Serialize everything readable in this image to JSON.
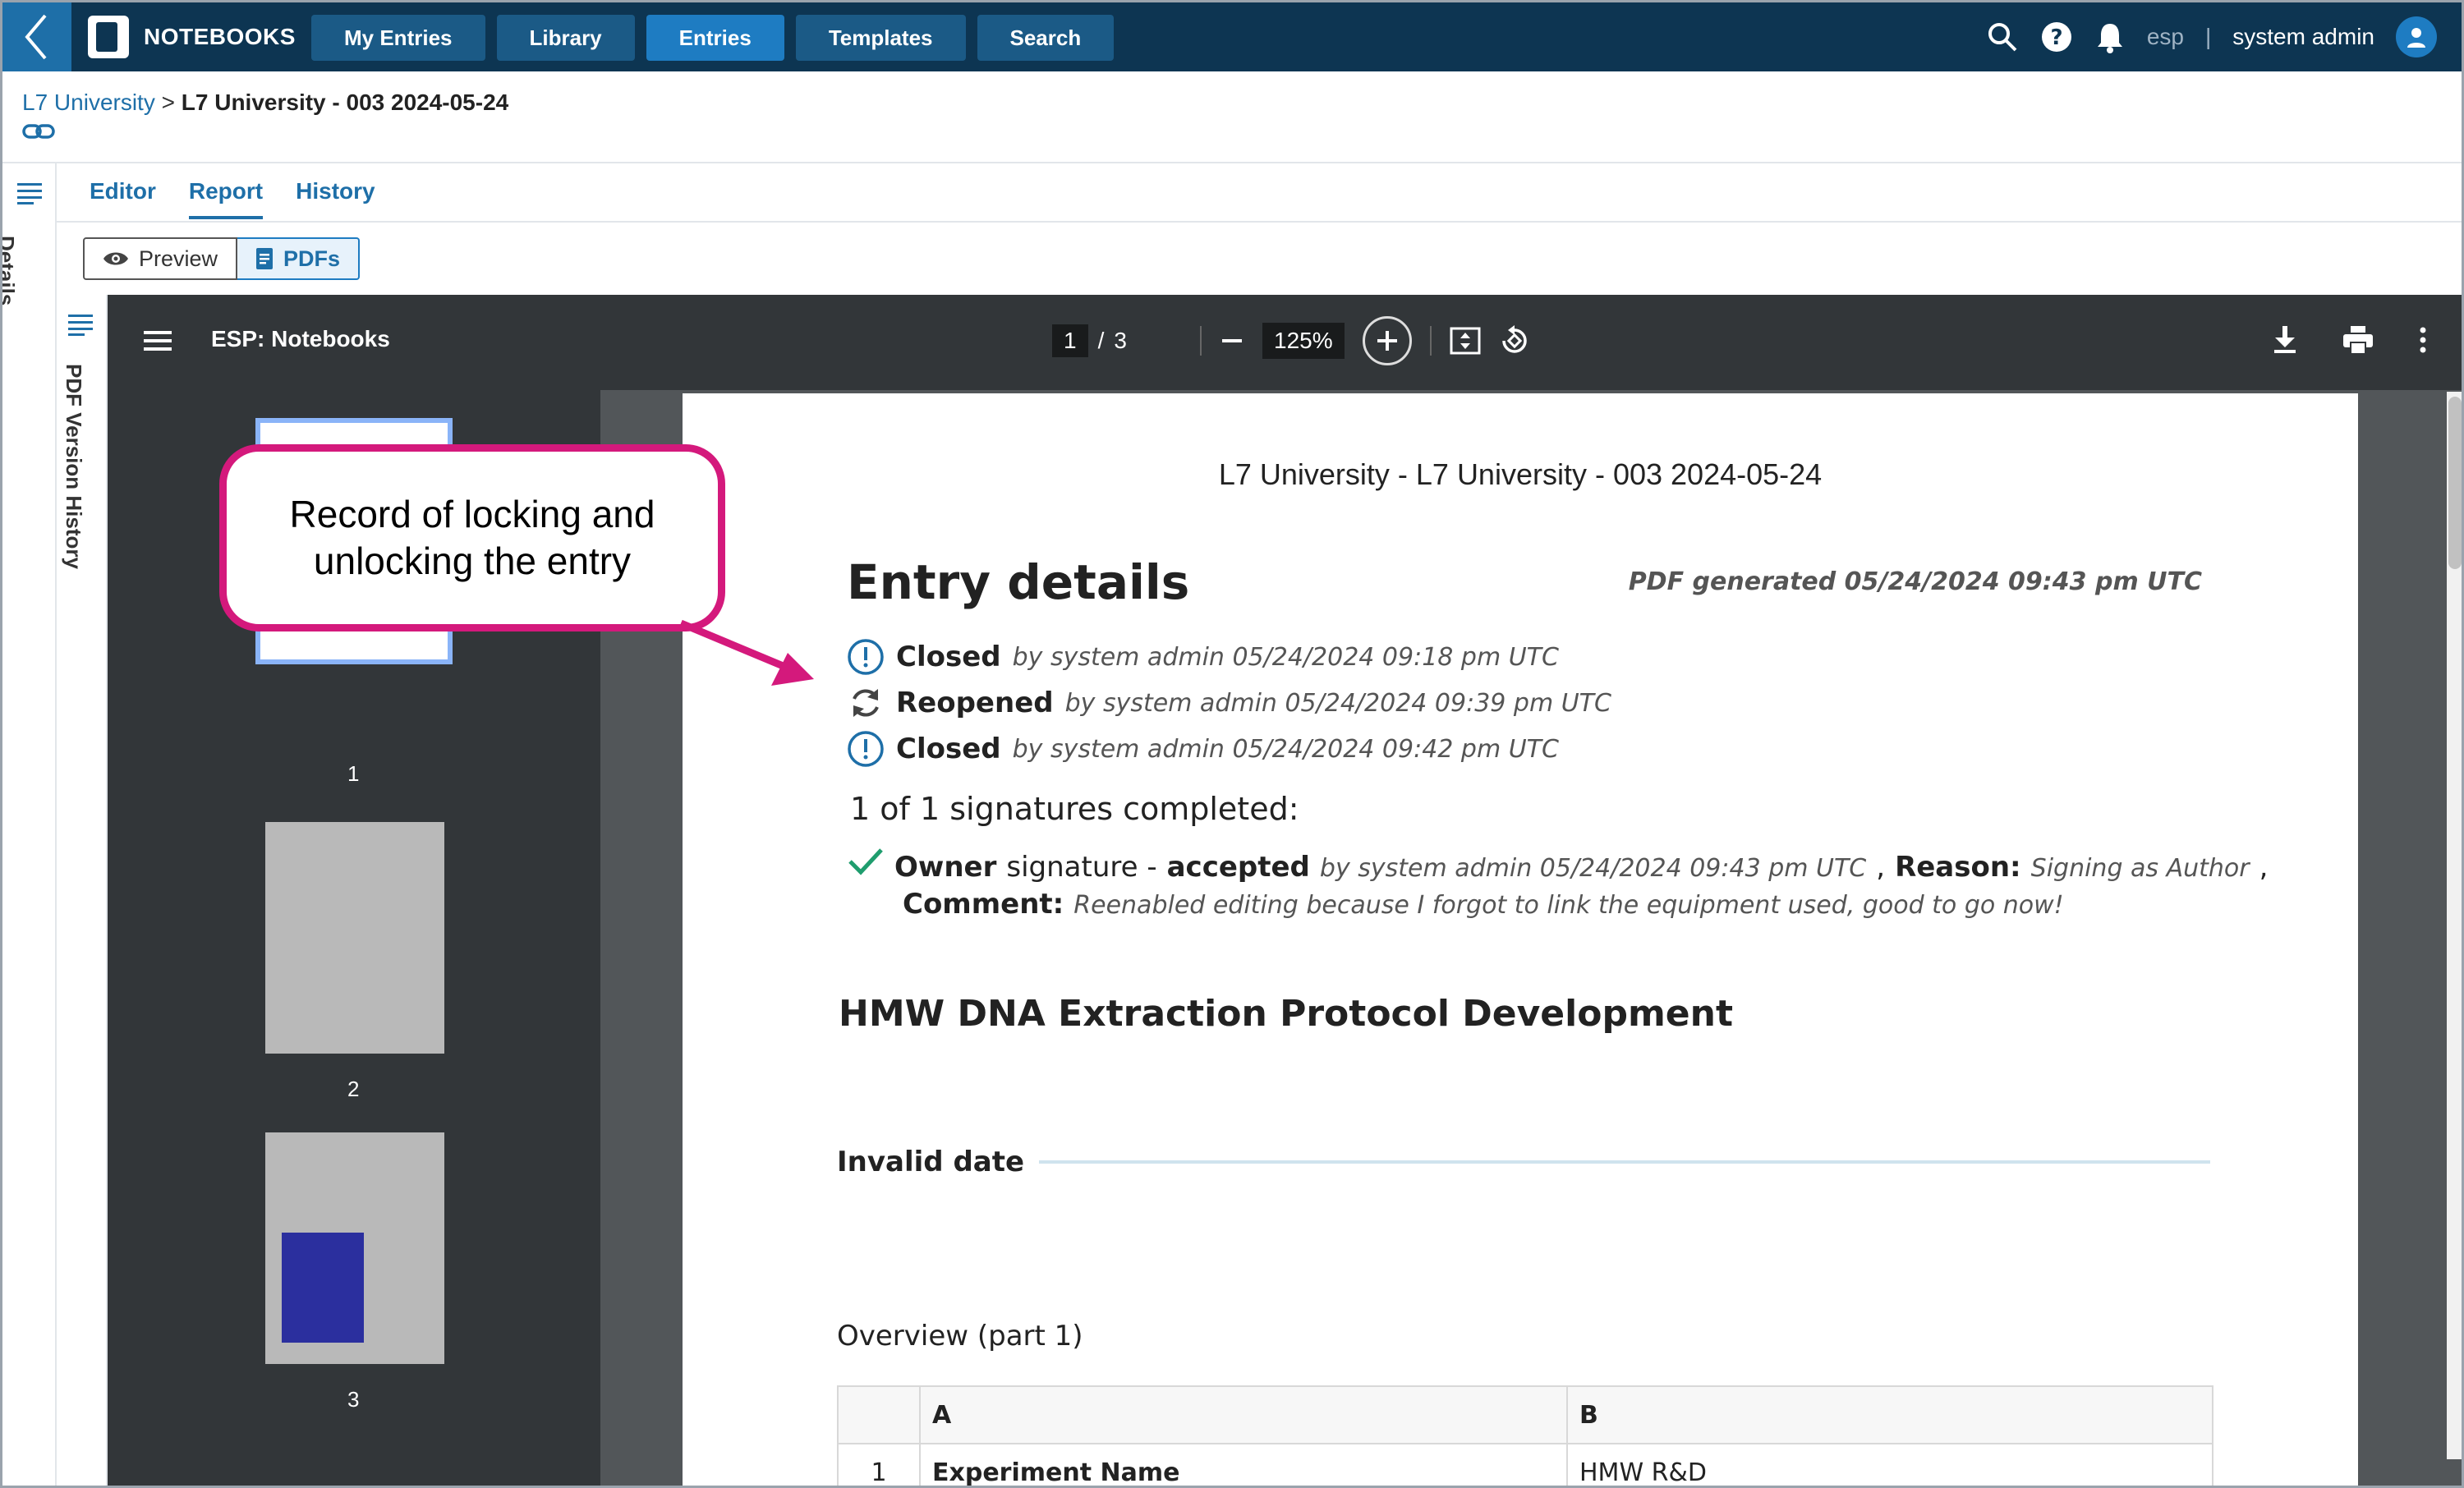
{
  "app": {
    "name": "NOTEBOOKS"
  },
  "nav": {
    "items": [
      {
        "label": "My Entries"
      },
      {
        "label": "Library"
      },
      {
        "label": "Entries"
      },
      {
        "label": "Templates"
      },
      {
        "label": "Search"
      }
    ],
    "active": "Entries"
  },
  "user": {
    "tenant": "esp",
    "tenant_sep": "|",
    "name": "system admin"
  },
  "breadcrumb": {
    "parent": "L7 University",
    "sep": ">",
    "current": "L7 University - 003 2024-05-24"
  },
  "rail": {
    "details_label": "Details"
  },
  "tabs": [
    {
      "label": "Editor"
    },
    {
      "label": "Report"
    },
    {
      "label": "History"
    }
  ],
  "toggles": {
    "preview": "Preview",
    "pdfs": "PDFs"
  },
  "history_rail": {
    "label": "PDF Version History"
  },
  "viewer": {
    "title": "ESP: Notebooks",
    "current_page": "1",
    "page_sep": "/",
    "total_pages": "3",
    "zoom": "125%",
    "thumbs": [
      {
        "num": "1"
      },
      {
        "num": "2"
      },
      {
        "num": "3"
      }
    ]
  },
  "pdf": {
    "header": "L7 University - L7 University - 003 2024-05-24",
    "title": "Entry details",
    "generated": "PDF generated 05/24/2024 09:43 pm UTC",
    "events": [
      {
        "icon": "alert-circle-icon",
        "label": "Closed",
        "meta": "by system admin 05/24/2024 09:18 pm UTC"
      },
      {
        "icon": "refresh-icon",
        "label": "Reopened",
        "meta": "by system admin 05/24/2024 09:39 pm UTC"
      },
      {
        "icon": "alert-circle-icon",
        "label": "Closed",
        "meta": "by system admin 05/24/2024 09:42 pm UTC"
      }
    ],
    "signatures": {
      "heading": "1 of 1 signatures completed:",
      "role": "Owner",
      "word": "signature -",
      "status": "accepted",
      "meta": "by system admin 05/24/2024 09:43 pm UTC",
      "comma": ",",
      "reason_label": "Reason:",
      "reason": "Signing as Author",
      "comment_label": "Comment:",
      "comment": "Reenabled editing because I forgot to link the equipment used, good to go now!"
    },
    "protocol_title": "HMW DNA Extraction Protocol Development",
    "date_label": "Invalid date",
    "overview_title": "Overview (part 1)",
    "table": {
      "headers": [
        "",
        "A",
        "B"
      ],
      "rows": [
        [
          "1",
          "Experiment Name",
          "HMW R&D"
        ]
      ]
    }
  },
  "callout": {
    "line1": "Record of locking and",
    "line2": "unlocking the entry"
  },
  "colors": {
    "topbar": "#0d3552",
    "accent": "#1e7cc2",
    "callout": "#d4197c",
    "check": "#1f9d6e"
  }
}
